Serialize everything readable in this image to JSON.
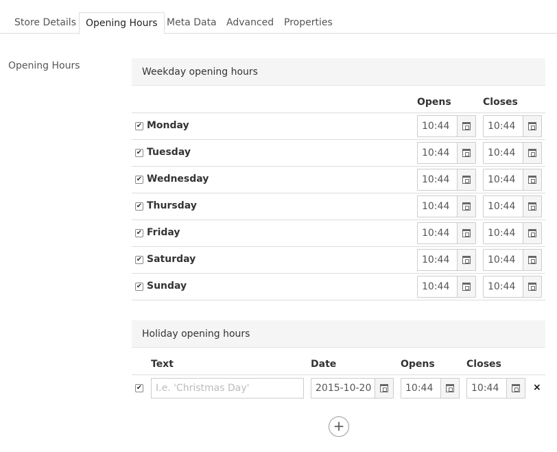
{
  "tabs": [
    {
      "label": "Store Details"
    },
    {
      "label": "Opening Hours"
    },
    {
      "label": "Meta Data"
    },
    {
      "label": "Advanced"
    },
    {
      "label": "Properties"
    }
  ],
  "active_tab": "Opening Hours",
  "section_label": "Opening Hours",
  "weekday": {
    "title": "Weekday opening hours",
    "col_opens": "Opens",
    "col_closes": "Closes",
    "days": [
      {
        "name": "Monday",
        "checked": true,
        "opens": "10:44",
        "closes": "10:44"
      },
      {
        "name": "Tuesday",
        "checked": true,
        "opens": "10:44",
        "closes": "10:44"
      },
      {
        "name": "Wednesday",
        "checked": true,
        "opens": "10:44",
        "closes": "10:44"
      },
      {
        "name": "Thursday",
        "checked": true,
        "opens": "10:44",
        "closes": "10:44"
      },
      {
        "name": "Friday",
        "checked": true,
        "opens": "10:44",
        "closes": "10:44"
      },
      {
        "name": "Saturday",
        "checked": true,
        "opens": "10:44",
        "closes": "10:44"
      },
      {
        "name": "Sunday",
        "checked": true,
        "opens": "10:44",
        "closes": "10:44"
      }
    ]
  },
  "holiday": {
    "title": "Holiday opening hours",
    "col_text": "Text",
    "col_date": "Date",
    "col_opens": "Opens",
    "col_closes": "Closes",
    "rows": [
      {
        "checked": true,
        "text_placeholder": "I.e. 'Christmas Day'",
        "date": "2015-10-20",
        "opens": "10:44",
        "closes": "10:44"
      }
    ],
    "remove_label": "×",
    "add_label": "+"
  },
  "icons": {
    "checkbox_checked": "✔",
    "calendar": "calendar-icon"
  }
}
